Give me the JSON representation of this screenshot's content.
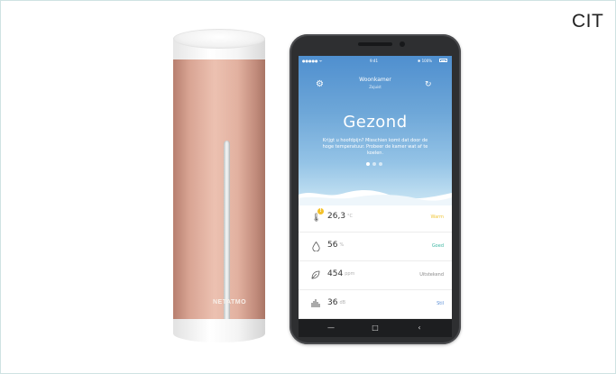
{
  "corner_label": "CIT",
  "device": {
    "brand": "NETATMO"
  },
  "phone": {
    "status_bar": {
      "carrier": "●●●●● ᯤ",
      "time": "9:41",
      "battery": "✱ 100%"
    },
    "room_title": "Woonkamer",
    "room_subtitle": "Zojuist",
    "air_status": "Gezond",
    "message": "Krijgt u hoofdpijn? Misschien komt dat door de hoge temperatuur. Probeer de kamer wat af te koelen.",
    "page_dots": 3,
    "active_dot": 0,
    "readings": [
      {
        "icon": "thermometer-icon",
        "value": "26,3",
        "unit": "°C",
        "status": "Warm",
        "status_color": "#f0c63a",
        "warning": "!"
      },
      {
        "icon": "humidity-drop-icon",
        "value": "56",
        "unit": "%",
        "status": "Goed",
        "status_color": "#3fb7a3"
      },
      {
        "icon": "leaf-icon",
        "value": "454",
        "unit": "ppm",
        "status": "Uitstekend",
        "status_color": "#8a8a8a"
      },
      {
        "icon": "sound-bars-icon",
        "value": "36",
        "unit": "dB",
        "status": "Stil",
        "status_color": "#5b8fd6"
      }
    ],
    "nav": {
      "back_icon": "‹",
      "home_icon": "□",
      "menu_icon": "—"
    }
  }
}
